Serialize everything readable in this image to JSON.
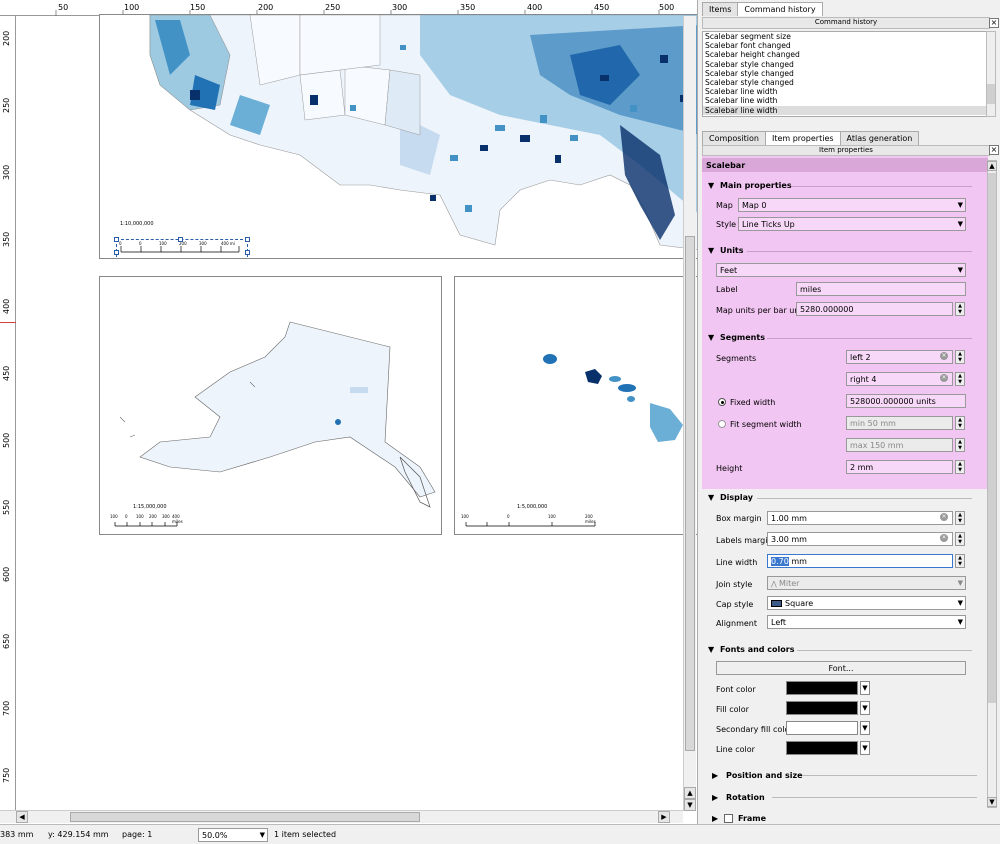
{
  "ruler": {
    "top": [
      "50",
      "100",
      "150",
      "200",
      "250",
      "300",
      "350",
      "400",
      "450",
      "500"
    ],
    "left": [
      "200",
      "250",
      "300",
      "350",
      "400",
      "450",
      "500",
      "550",
      "600",
      "650",
      "700",
      "750"
    ]
  },
  "maps": {
    "main": {
      "scale_text": "1:10,000,000",
      "ticks": [
        "0",
        "0",
        "100",
        "200",
        "300",
        "400 mi"
      ]
    },
    "alaska": {
      "scale_text": "1:15,000,000",
      "ticks": [
        "100",
        "0",
        "100",
        "200",
        "300",
        "400 miles"
      ]
    },
    "hawaii": {
      "scale_text": "1:5,000,000",
      "ticks": [
        "100",
        "0",
        "100",
        "200 miles"
      ]
    }
  },
  "status": {
    "x": "383 mm",
    "y": "y: 429.154 mm",
    "page": "page: 1",
    "zoom": "50.0%",
    "selection": "1 item selected"
  },
  "top_tabs": [
    {
      "label": "Items",
      "active": false
    },
    {
      "label": "Command history",
      "active": true
    }
  ],
  "history_title": "Command history",
  "history": [
    "Scalebar segment size",
    "Scalebar font changed",
    "Scalebar height changed",
    "Scalebar style changed",
    "Scalebar style changed",
    "Scalebar style changed",
    "Scalebar line width",
    "Scalebar line width",
    "Scalebar line width"
  ],
  "bottom_tabs": [
    {
      "label": "Composition",
      "active": false
    },
    {
      "label": "Item properties",
      "active": true
    },
    {
      "label": "Atlas generation",
      "active": false
    }
  ],
  "props_title": "Item properties",
  "item_header": "Scalebar",
  "main_properties": {
    "heading": "Main properties",
    "map_label": "Map",
    "map_value": "Map 0",
    "style_label": "Style",
    "style_value": "Line Ticks Up"
  },
  "units": {
    "heading": "Units",
    "unit_value": "Feet",
    "label_label": "Label",
    "label_value": "miles",
    "mupu_label": "Map units per bar unit",
    "mupu_value": "5280.000000"
  },
  "segments": {
    "heading": "Segments",
    "segments_label": "Segments",
    "left_value": "left 2",
    "right_value": "right 4",
    "fixed_label": "Fixed width",
    "fixed_value": "528000.000000 units",
    "fit_label": "Fit segment width",
    "min_value": "min 50 mm",
    "max_value": "max 150 mm",
    "height_label": "Height",
    "height_value": "2 mm"
  },
  "display": {
    "heading": "Display",
    "box_margin_label": "Box margin",
    "box_margin_value": "1.00 mm",
    "labels_margin_label": "Labels margin",
    "labels_margin_value": "3.00 mm",
    "line_width_label": "Line width",
    "line_width_selected": "0.70",
    "line_width_unit": " mm",
    "join_label": "Join style",
    "join_value": "Miter",
    "cap_label": "Cap style",
    "cap_value": "Square",
    "align_label": "Alignment",
    "align_value": "Left"
  },
  "fonts": {
    "heading": "Fonts and colors",
    "font_button": "Font...",
    "font_color_label": "Font color",
    "font_color": "#000000",
    "fill_color_label": "Fill color",
    "fill_color": "#000000",
    "secondary_label": "Secondary fill color",
    "secondary_color": "#ffffff",
    "line_color_label": "Line color",
    "line_color": "#000000"
  },
  "collapsed": {
    "position": "Position and size",
    "rotation": "Rotation",
    "frame": "Frame"
  },
  "colors": {
    "highlight": "#f2c6f2",
    "map_dark": "#08306b",
    "map_mid": "#4292c6",
    "map_light": "#c6dbef"
  }
}
